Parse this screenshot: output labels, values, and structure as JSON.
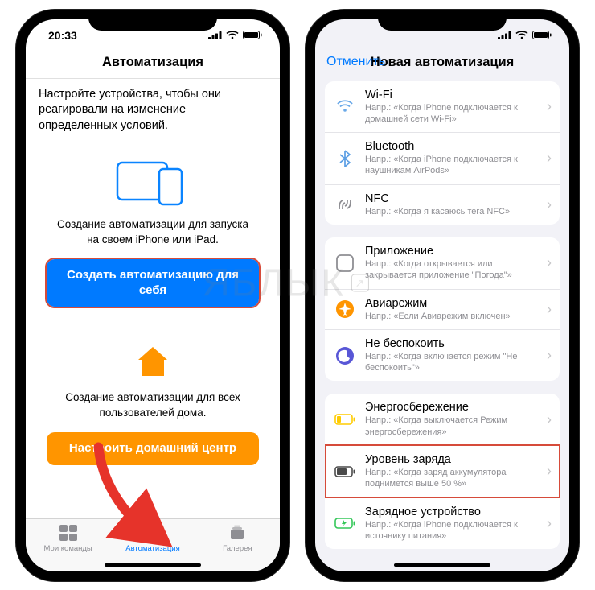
{
  "watermark": "ЯБЛЫК",
  "left_phone": {
    "time": "20:33",
    "nav_title": "Автоматизация",
    "intro": "Настройте устройства, чтобы они реагировали на изменение определенных условий.",
    "card_personal": {
      "text": "Создание автоматизации для запуска на своем iPhone или iPad.",
      "button": "Создать автоматизацию для себя"
    },
    "card_home": {
      "text": "Создание автоматизации для всех пользователей дома.",
      "button": "Настроить домашний центр"
    },
    "tabs": {
      "my": "Мои команды",
      "automation": "Автоматизация",
      "gallery": "Галерея"
    }
  },
  "right_phone": {
    "nav_cancel": "Отменить",
    "nav_title": "Новая автоматизация",
    "groups": [
      {
        "rows": [
          {
            "icon": "wifi",
            "title": "Wi-Fi",
            "sub": "Напр.: «Когда iPhone подключается к домашней сети Wi-Fi»"
          },
          {
            "icon": "bluetooth",
            "title": "Bluetooth",
            "sub": "Напр.: «Когда iPhone подключается к наушникам AirPods»"
          },
          {
            "icon": "nfc",
            "title": "NFC",
            "sub": "Напр.: «Когда я касаюсь тега NFC»"
          }
        ]
      },
      {
        "rows": [
          {
            "icon": "app",
            "title": "Приложение",
            "sub": "Напр.: «Когда открывается или закрывается приложение \"Погода\"»"
          },
          {
            "icon": "airplane",
            "title": "Авиарежим",
            "sub": "Напр.: «Если Авиарежим включен»"
          },
          {
            "icon": "dnd",
            "title": "Не беспокоить",
            "sub": "Напр.: «Когда включается режим \"Не беспокоить\"»"
          }
        ]
      },
      {
        "rows": [
          {
            "icon": "lowpower",
            "title": "Энергосбережение",
            "sub": "Напр.: «Когда выключается Режим энергосбережения»"
          },
          {
            "icon": "battery",
            "title": "Уровень заряда",
            "sub": "Напр.: «Когда заряд аккумулятора поднимется выше 50 %»",
            "highlight": true
          },
          {
            "icon": "charger",
            "title": "Зарядное устройство",
            "sub": "Напр.: «Когда iPhone подключается к источнику питания»"
          }
        ]
      }
    ]
  }
}
